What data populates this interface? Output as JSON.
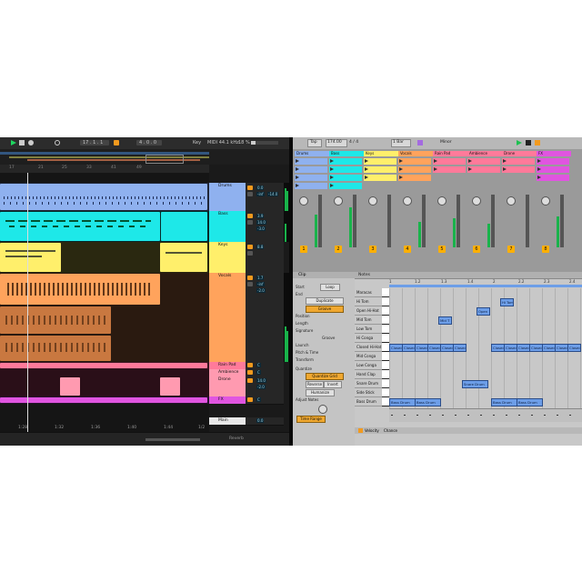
{
  "arrangement": {
    "toolbar": {
      "bar_position": "17 . 1 . 1",
      "loop_start": "4 . 0 . 0",
      "key": "Key",
      "midi_status": "MIDI 44.1 kHz",
      "cpu": "18 %"
    },
    "ruler": [
      "17",
      "21",
      "25",
      "33",
      "41",
      "49"
    ],
    "tracks": [
      {
        "name": "Drums",
        "color": "#8fb1ef",
        "vol": "0.0",
        "pan": "-inf",
        "send": "-14.0"
      },
      {
        "name": "Bass",
        "color": "#1ee8e8",
        "vol": "3.9",
        "pan": "14.0",
        "send": "-3.0"
      },
      {
        "name": "Keys",
        "color": "#ffef6b",
        "vol": "8.8",
        "pan": "",
        "send": ""
      },
      {
        "name": "Vocals",
        "color": "#ffa35c",
        "vol": "1.7",
        "pan": "-inf",
        "send": "-2.0"
      },
      {
        "name": "Rain Pad",
        "color": "#ff7a9a",
        "vol": "C",
        "pan": "",
        "send": ""
      },
      {
        "name": "Ambience",
        "color": "#ff7a9a",
        "vol": "C",
        "pan": "",
        "send": ""
      },
      {
        "name": "Drone",
        "color": "#ff7a9a",
        "vol": "14.0",
        "pan": "",
        "send": "-2.0"
      },
      {
        "name": "FX",
        "color": "#e055e0",
        "vol": "C",
        "pan": "",
        "send": ""
      },
      {
        "name": "Main",
        "color": "#e8e8e8",
        "vol": "0.0",
        "pan": "",
        "send": ""
      }
    ],
    "bottom": {
      "times": [
        "1:28",
        "1:32",
        "1:36",
        "1:40",
        "1:44"
      ],
      "zoom": "1/2",
      "device": "Reverb"
    }
  },
  "session": {
    "toolbar": {
      "tap": "Tap",
      "tempo": "174.00",
      "sig": "4 / 4",
      "quant": "1 Bar",
      "mode": "Minor"
    },
    "tracks": [
      {
        "name": "Drums",
        "color": "#8fb1ef",
        "num": "1"
      },
      {
        "name": "Bass",
        "color": "#1ee8e8",
        "num": "2"
      },
      {
        "name": "Keys",
        "color": "#ffef6b",
        "num": "3"
      },
      {
        "name": "Vocals",
        "color": "#ffa35c",
        "num": "4"
      },
      {
        "name": "Rain Pad",
        "color": "#ff7a9a",
        "num": "5"
      },
      {
        "name": "Ambience",
        "color": "#ff7a9a",
        "num": "6"
      },
      {
        "name": "Drone",
        "color": "#ff7a9a",
        "num": "7"
      },
      {
        "name": "FX",
        "color": "#e055e0",
        "num": "8"
      }
    ]
  },
  "clip": {
    "title": "Clip",
    "rows": [
      "Start",
      "End",
      "Position",
      "Length",
      "Signature",
      "Groove",
      "Launch",
      "Pitch & Time",
      "Transform",
      "Quantize",
      "Adjust Notes"
    ],
    "buttons": {
      "loop": "Loop",
      "duplicate": "Duplicate",
      "groove": "Groove",
      "reverse": "Reverse",
      "invert": "Invert",
      "humanize": "Humanize",
      "quantize_grid": "Quantize Grid",
      "time_range": "Time Range"
    }
  },
  "notes": {
    "header": "Notes",
    "ruler": [
      "1",
      "1.2",
      "1.3",
      "1.4",
      "2",
      "2.2",
      "2.3",
      "2.4"
    ],
    "lanes": [
      "Maracas",
      "Hi Tom",
      "Open Hi-Hat",
      "Mid Tom",
      "Low Tom",
      "Hi Conga",
      "Closed Hi-Hat",
      "Mid Conga",
      "Low Conga",
      "Hand Clap",
      "Snare Drum",
      "Side Stick",
      "Bass Drum"
    ],
    "note_labels": {
      "snare": "Snare Drum",
      "bass": "Bass Drum",
      "closed": "Closed",
      "hitom": "Hi Tom",
      "open": "Open",
      "mid": "Mid T"
    },
    "velocity": "Velocity",
    "chance": "Chance"
  }
}
